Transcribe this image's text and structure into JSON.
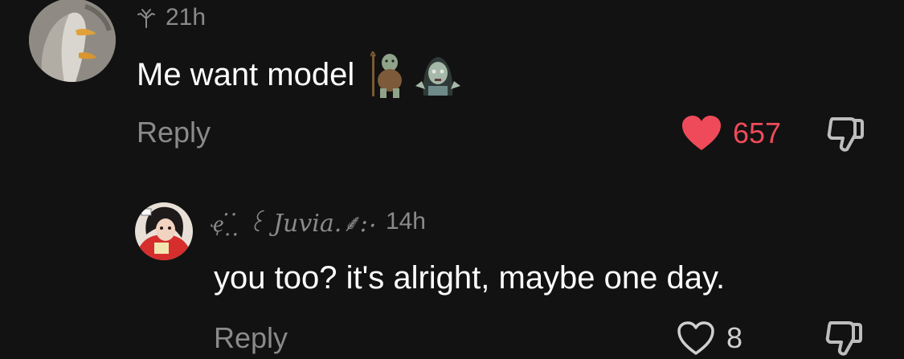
{
  "comment": {
    "avatar_icon": "penguin-avatar",
    "badge_icon": "sprout-icon",
    "time": "21h",
    "text": "Me want model",
    "emojis": [
      "troll-emoji",
      "zombie-woman-emoji"
    ],
    "reply_label": "Reply",
    "likes": "657",
    "liked": true,
    "like_color": "#ef4a5a",
    "dislike_icon": "thumbs-down-icon"
  },
  "reply": {
    "avatar_icon": "anime-character-avatar",
    "username": "ҿ ̣̇ ̣̣̇ ꒰ Juvia.⸙:‧",
    "time": "14h",
    "text": "you too? it's alright, maybe one day.",
    "reply_label": "Reply",
    "likes": "8",
    "liked": false,
    "dislike_icon": "thumbs-down-icon"
  },
  "colors": {
    "background": "#121212",
    "text_primary": "#ffffff",
    "text_secondary": "#8a8a8a",
    "like_active": "#ef4a5a"
  }
}
